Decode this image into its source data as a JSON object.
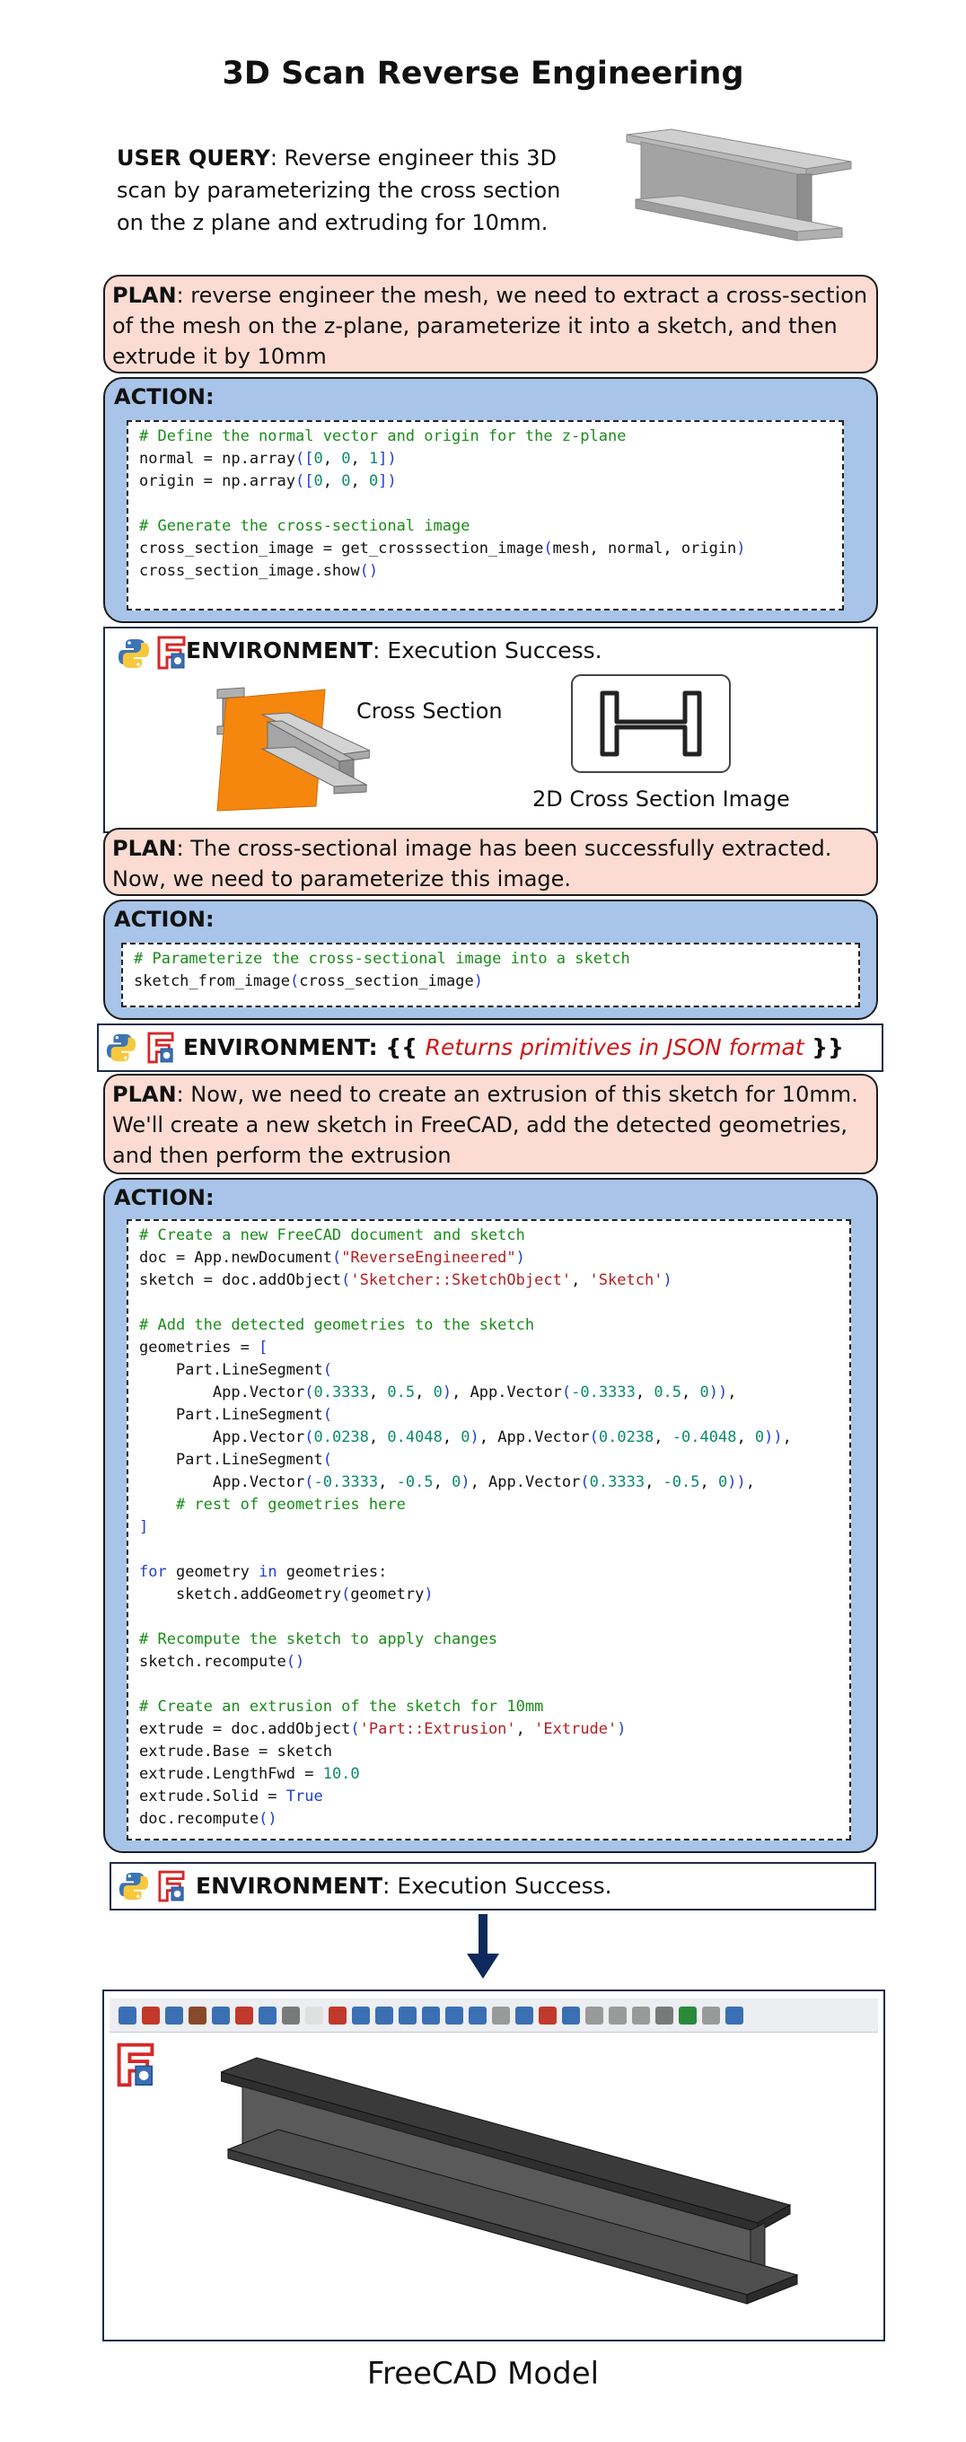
{
  "title": "3D Scan Reverse Engineering",
  "query": {
    "label": "USER QUERY",
    "text": ": Reverse engineer this 3D scan by parameterizing the cross section on the z plane and extruding for 10mm."
  },
  "plan1": {
    "label": "PLAN",
    "text": ": reverse engineer the mesh, we need to extract a cross-section of the mesh on the z-plane, parameterize it into a sketch, and then extrude it by 10mm"
  },
  "action_label": "ACTION:",
  "action1_code": [
    "# Define the normal vector and origin for the z-plane",
    "normal = np.array([0, 0, 1])",
    "origin = np.array([0, 0, 0])",
    "",
    "# Generate the cross-sectional image",
    "cross_section_image = get_crosssection_image(mesh, normal, origin)",
    "cross_section_image.show()"
  ],
  "env1": {
    "label": "ENVIRONMENT",
    "text": ": Execution Success.",
    "cross_section_label": "Cross Section",
    "image_label": "2D Cross Section Image"
  },
  "plan2": {
    "label": "PLAN",
    "text": ": The cross-sectional image has been successfully extracted. Now, we need to parameterize this image."
  },
  "action2_code": [
    "# Parameterize the cross-sectional image into a sketch",
    "sketch_from_image(cross_section_image)"
  ],
  "env2": {
    "label": "ENVIRONMENT",
    "prefix": ": {{ ",
    "returns": "Returns primitives in JSON format",
    "suffix": " }}"
  },
  "plan3": {
    "label": "PLAN",
    "text": ": Now, we need to create an extrusion of this sketch for 10mm. We'll create a new sketch in FreeCAD, add the detected geometries, and then perform the extrusion"
  },
  "action3_code": [
    "# Create a new FreeCAD document and sketch",
    "doc = App.newDocument(\"ReverseEngineered\")",
    "sketch = doc.addObject('Sketcher::SketchObject', 'Sketch')",
    "",
    "# Add the detected geometries to the sketch",
    "geometries = [",
    "    Part.LineSegment(",
    "        App.Vector(0.3333, 0.5, 0), App.Vector(-0.3333, 0.5, 0)),",
    "    Part.LineSegment(",
    "        App.Vector(0.0238, 0.4048, 0), App.Vector(0.0238, -0.4048, 0)),",
    "    Part.LineSegment(",
    "        App.Vector(-0.3333, -0.5, 0), App.Vector(0.3333, -0.5, 0)),",
    "    # rest of geometries here",
    "]",
    "",
    "for geometry in geometries:",
    "    sketch.addGeometry(geometry)",
    "",
    "# Recompute the sketch to apply changes",
    "sketch.recompute()",
    "",
    "# Create an extrusion of the sketch for 10mm",
    "extrude = doc.addObject('Part::Extrusion', 'Extrude')",
    "extrude.Base = sketch",
    "extrude.LengthFwd = 10.0",
    "extrude.Solid = True",
    "doc.recompute()"
  ],
  "env3": {
    "label": "ENVIRONMENT",
    "text": ": Execution Success."
  },
  "model_caption": "FreeCAD Model",
  "colors": {
    "plan_bg": "#fcdcd2",
    "action_bg": "#a8c4e8",
    "arrow": "#0e2a5c",
    "error_text": "#d21414"
  }
}
